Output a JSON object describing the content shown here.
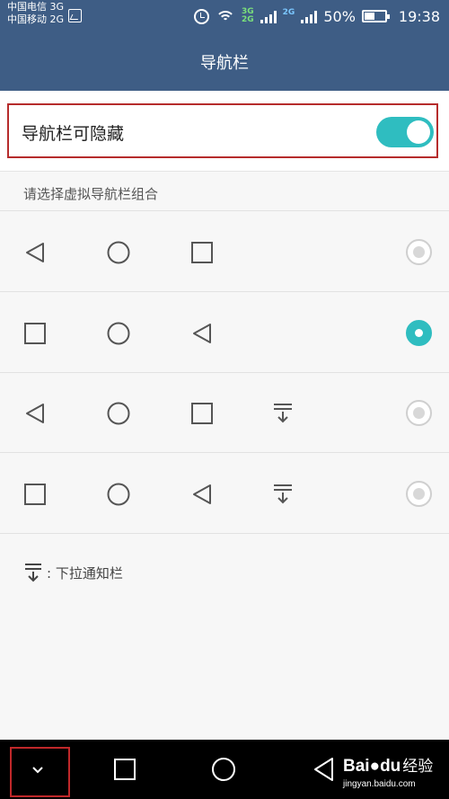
{
  "status_bar": {
    "carrier1": "中国电信 3G",
    "carrier2": "中国移动 2G",
    "net_a_top": "3G",
    "net_a_bottom": "2G",
    "net_b": "2G",
    "battery": "50%",
    "time": "19:38"
  },
  "header": {
    "title": "导航栏"
  },
  "toggle": {
    "label": "导航栏可隐藏",
    "on": true
  },
  "section": {
    "title": "请选择虚拟导航栏组合"
  },
  "options": [
    {
      "buttons": [
        "back-icon",
        "home-icon",
        "recent-icon"
      ],
      "selected": false
    },
    {
      "buttons": [
        "recent-icon",
        "home-icon",
        "back-icon"
      ],
      "selected": true
    },
    {
      "buttons": [
        "back-icon",
        "home-icon",
        "recent-icon",
        "pull-down-icon"
      ],
      "selected": false
    },
    {
      "buttons": [
        "recent-icon",
        "home-icon",
        "back-icon",
        "pull-down-icon"
      ],
      "selected": false
    }
  ],
  "legend": {
    "text": ": 下拉通知栏",
    "icon": "pull-down-icon"
  },
  "system_nav": {
    "buttons": [
      "chevron-down-icon",
      "recent-icon",
      "home-icon",
      "back-icon"
    ]
  },
  "watermark": {
    "brand": "Bai",
    "brand2": "du",
    "suffix": "经验",
    "url": "jingyan.baidu.com"
  },
  "colors": {
    "header_bg": "#3e5d85",
    "accent": "#2fbdc0",
    "highlight": "#b62c2c"
  }
}
